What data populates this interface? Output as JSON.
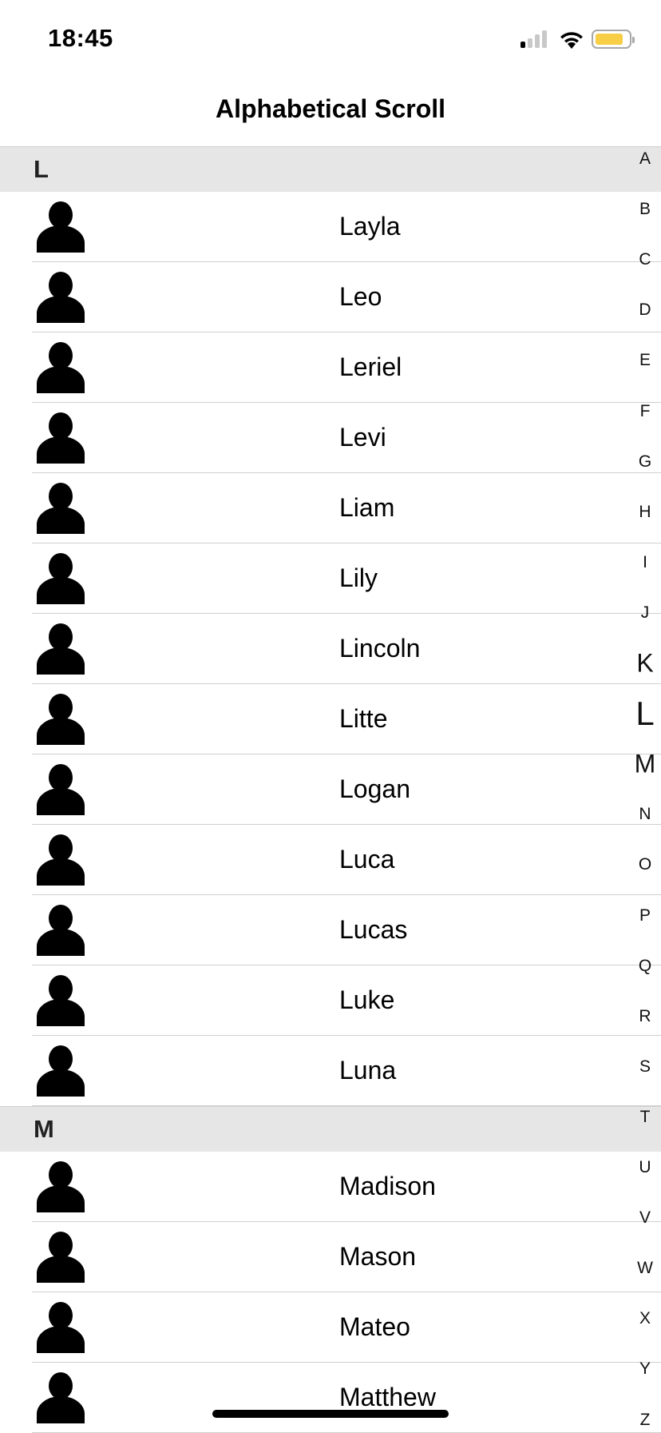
{
  "status_bar": {
    "time": "18:45",
    "signal_icon": "cellular-signal-icon",
    "wifi_icon": "wifi-icon",
    "battery_icon": "battery-icon",
    "battery_color": "#f7ce46"
  },
  "nav": {
    "title": "Alphabetical Scroll"
  },
  "sections": [
    {
      "letter": "L",
      "names": [
        "Layla",
        "Leo",
        "Leriel",
        "Levi",
        "Liam",
        "Lily",
        "Lincoln",
        "Litte",
        "Logan",
        "Luca",
        "Lucas",
        "Luke",
        "Luna"
      ]
    },
    {
      "letter": "M",
      "names": [
        "Madison",
        "Mason",
        "Mateo",
        "Matthew"
      ]
    }
  ],
  "index_letters": [
    "A",
    "B",
    "C",
    "D",
    "E",
    "F",
    "G",
    "H",
    "I",
    "J",
    "K",
    "L",
    "M",
    "N",
    "O",
    "P",
    "Q",
    "R",
    "S",
    "T",
    "U",
    "V",
    "W",
    "X",
    "Y",
    "Z"
  ],
  "index_active": "L",
  "index_neighbors": [
    "K",
    "M"
  ]
}
